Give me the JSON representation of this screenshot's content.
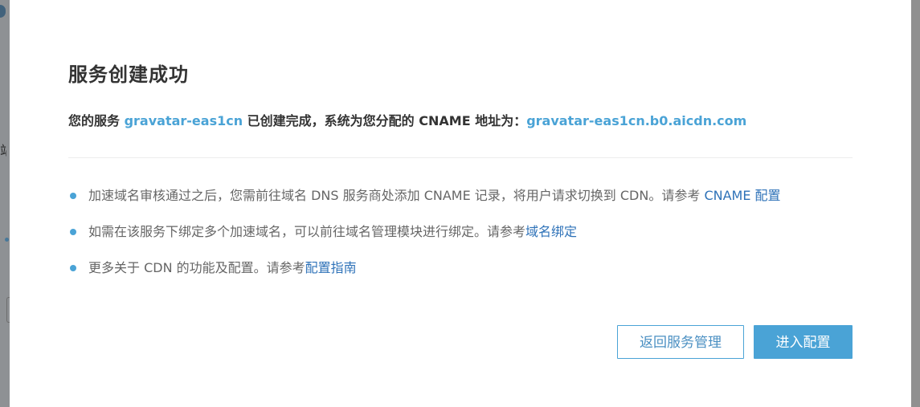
{
  "background_glyph": "站",
  "dialog": {
    "title": "服务创建成功",
    "summary": {
      "prefix": "您的服务 ",
      "service_name": "gravatar-eas1cn",
      "middle": " 已创建完成，系统为您分配的 CNAME 地址为：",
      "cname": "gravatar-eas1cn.b0.aicdn.com"
    },
    "notes": [
      {
        "text": "加速域名审核通过之后，您需前往域名 DNS 服务商处添加 CNAME 记录，将用户请求切换到 CDN。请参考 ",
        "link": "CNAME 配置"
      },
      {
        "text": "如需在该服务下绑定多个加速域名，可以前往域名管理模块进行绑定。请参考",
        "link": "域名绑定"
      },
      {
        "text": "更多关于 CDN 的功能及配置。请参考",
        "link": "配置指南"
      }
    ],
    "buttons": {
      "back_label": "返回服务管理",
      "config_label": "进入配置"
    }
  },
  "colors": {
    "accent": "#4aa3d6",
    "link": "#2e72b8",
    "title_text": "#333333",
    "body_text": "#666666"
  }
}
